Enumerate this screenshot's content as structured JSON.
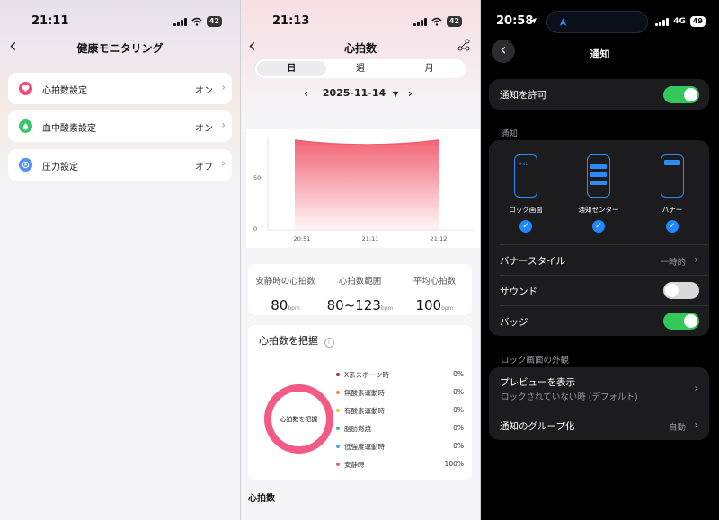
{
  "panel1": {
    "time": "21:11",
    "battery": "42",
    "title": "健康モニタリング",
    "items": [
      {
        "label": "心拍数設定",
        "value": "オン",
        "color": "#f04a78"
      },
      {
        "label": "血中酸素設定",
        "value": "オン",
        "color": "#3dc46c"
      },
      {
        "label": "圧力設定",
        "value": "オフ",
        "color": "#4f92f0"
      }
    ]
  },
  "panel2": {
    "time": "21:13",
    "battery": "42",
    "title": "心拍数",
    "tabs": [
      "日",
      "週",
      "月"
    ],
    "date": "2025-11-14",
    "stats": [
      {
        "title": "安静時の心拍数",
        "value": "80",
        "unit": "bpm"
      },
      {
        "title": "心拍数範囲",
        "value": "80~123",
        "unit": "bpm"
      },
      {
        "title": "平均心拍数",
        "value": "100",
        "unit": "bpm"
      }
    ],
    "zone_title": "心拍数を把握",
    "ring_label": "心拍数を把握",
    "zones": [
      {
        "name": "X系スポーツ時",
        "pct": "0%",
        "color": "#b0273a"
      },
      {
        "name": "無酸素運動時",
        "pct": "0%",
        "color": "#f28c28"
      },
      {
        "name": "有酸素運動時",
        "pct": "0%",
        "color": "#f2c12e"
      },
      {
        "name": "脂肪燃焼",
        "pct": "0%",
        "color": "#3dc46c"
      },
      {
        "name": "低強度運動時",
        "pct": "0%",
        "color": "#4aa8f0"
      },
      {
        "name": "安静時",
        "pct": "100%",
        "color": "#f35b84"
      }
    ],
    "bottom_label": "心拍数"
  },
  "chart_data": {
    "type": "area",
    "x": [
      "20:51",
      "21:11",
      "21:12"
    ],
    "y_ticks": [
      "50",
      "0"
    ],
    "fill_color": "#f25c6e"
  },
  "panel3": {
    "time": "20:58",
    "network": "4G",
    "battery": "49",
    "title": "通知",
    "allow_label": "通知を許可",
    "allow_on": true,
    "section_notify": "通知",
    "previews": [
      {
        "label": "ロック画面",
        "checked": true
      },
      {
        "label": "通知センター",
        "checked": true
      },
      {
        "label": "バナー",
        "checked": true
      }
    ],
    "banner_style_label": "バナースタイル",
    "banner_style_value": "一時的",
    "sound_label": "サウンド",
    "sound_on": false,
    "badge_label": "バッジ",
    "badge_on": true,
    "section_lock": "ロック画面の外観",
    "preview_label": "プレビューを表示",
    "preview_value": "ロックされていない時 (デフォルト)",
    "group_label": "通知のグループ化",
    "group_value": "自動"
  }
}
